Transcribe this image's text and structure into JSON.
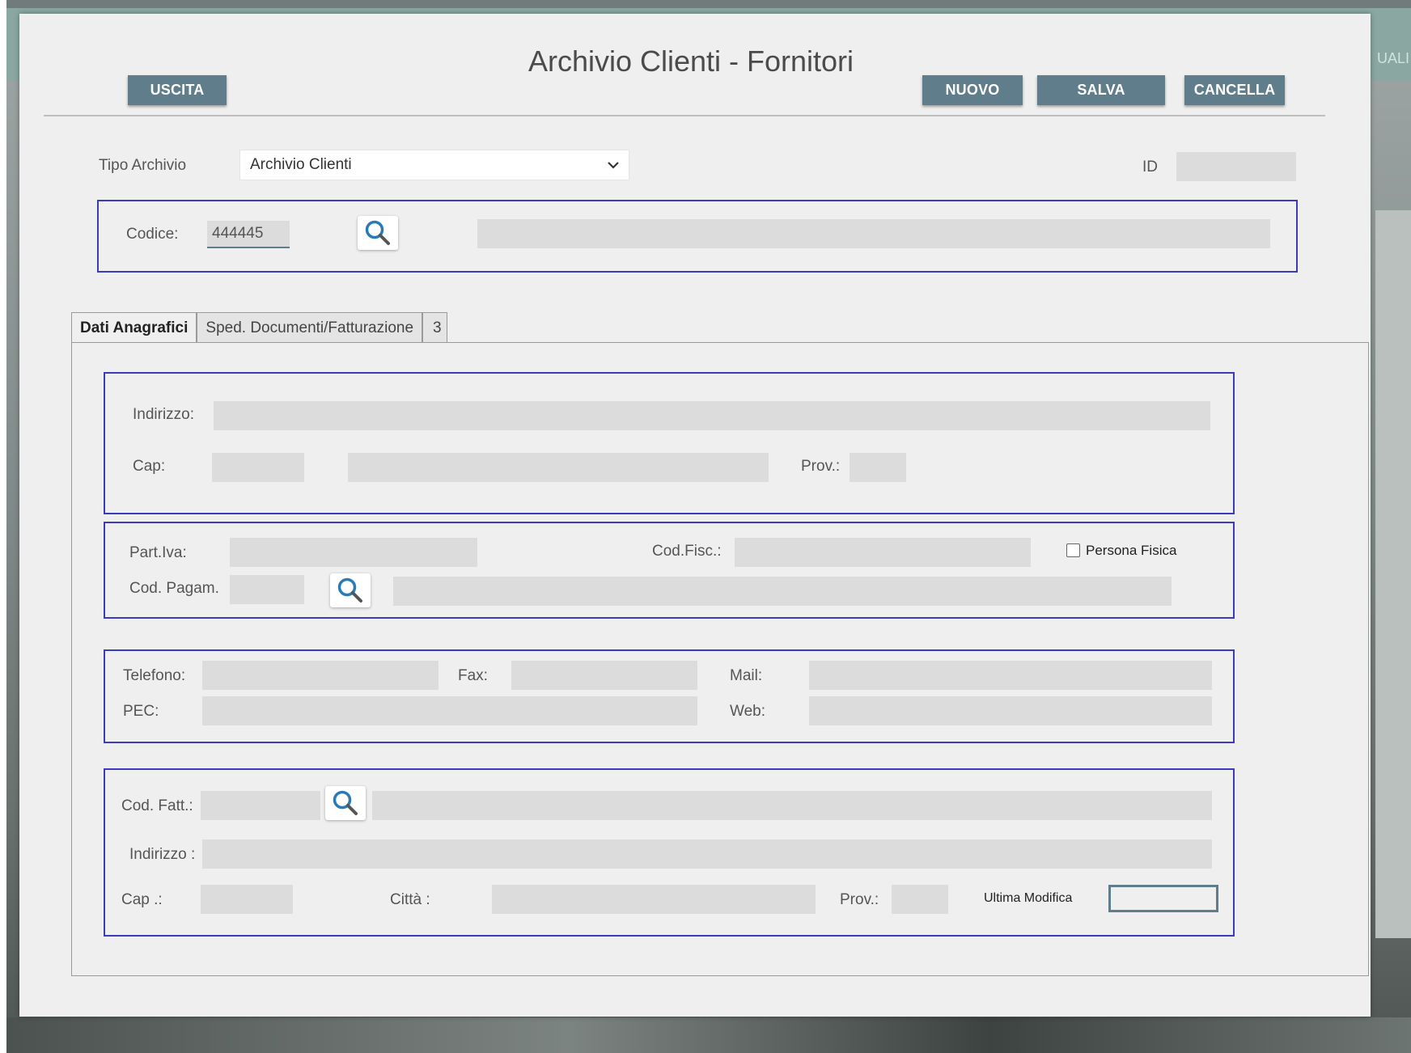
{
  "window": {
    "title": "Archivio Clienti - Fornitori",
    "corner_text": "UALI"
  },
  "toolbar": {
    "exit_label": "USCITA",
    "new_label": "NUOVO",
    "save_label": "SALVA",
    "delete_label": "CANCELLA"
  },
  "header": {
    "archive_type_label": "Tipo Archivio",
    "archive_type_value": "Archivio Clienti",
    "id_label": "ID",
    "id_value": ""
  },
  "code": {
    "label": "Codice:",
    "value": "444445",
    "description": ""
  },
  "tabs": [
    {
      "label": "Dati Anagrafici",
      "active": true
    },
    {
      "label": "Sped. Documenti/Fatturazione",
      "active": false
    },
    {
      "label": "3",
      "active": false
    }
  ],
  "address": {
    "address_label": "Indirizzo:",
    "address_value": "",
    "cap_label": "Cap:",
    "cap_value": "",
    "city_value": "",
    "prov_label": "Prov.:",
    "prov_value": ""
  },
  "fiscal": {
    "vat_label": "Part.Iva:",
    "vat_value": "",
    "tax_code_label": "Cod.Fisc.:",
    "tax_code_value": "",
    "natural_person_label": "Persona Fisica",
    "natural_person_checked": false,
    "payment_label": "Cod. Pagam.",
    "payment_value": "",
    "payment_description": ""
  },
  "contacts": {
    "phone_label": "Telefono:",
    "phone_value": "",
    "fax_label": "Fax:",
    "fax_value": "",
    "mail_label": "Mail:",
    "mail_value": "",
    "pec_label": "PEC:",
    "pec_value": "",
    "web_label": "Web:",
    "web_value": ""
  },
  "billing": {
    "code_label": "Cod. Fatt.:",
    "code_value": "",
    "code_description": "",
    "address_label": "Indirizzo :",
    "address_value": "",
    "cap_label": "Cap .:",
    "cap_value": "",
    "city_label": "Città :",
    "city_value": "",
    "prov_label": "Prov.:",
    "prov_value": "",
    "last_modified_label": "Ultima Modifica",
    "last_modified_value": ""
  },
  "icons": {
    "search": "search-icon",
    "dropdown": "chevron-down-icon"
  },
  "colors": {
    "button_bg": "#607d8b",
    "group_border": "#3b3bbf",
    "field_bg": "#dcdcdc"
  }
}
